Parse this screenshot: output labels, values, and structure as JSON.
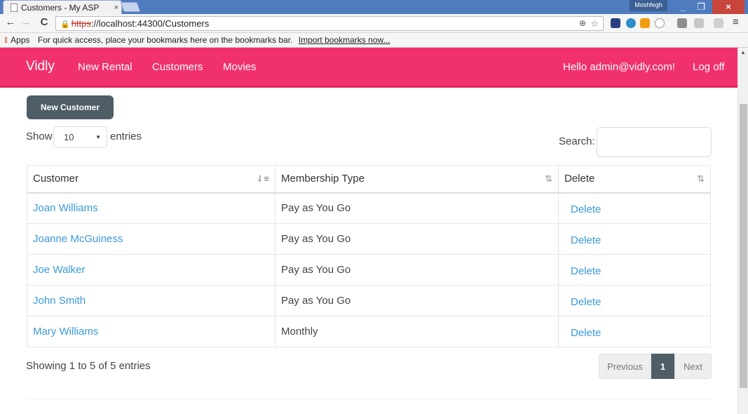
{
  "browser": {
    "tab_title": "Customers - My ASP",
    "tab_close": "×",
    "profile_name": "Moshfegh",
    "win_min": "_",
    "win_max": "❐",
    "win_close": "×",
    "url_scheme": "https",
    "url_rest": "://localhost:44300/Customers",
    "bookmarks_apps": "Apps",
    "bookmarks_hint": "For quick access, place your bookmarks here on the bookmarks bar.",
    "bookmarks_import": "Import bookmarks now..."
  },
  "navbar": {
    "brand": "Vidly",
    "links": [
      "New Rental",
      "Customers",
      "Movies"
    ],
    "greeting": "Hello admin@vidly.com!",
    "logoff": "Log off",
    "color": "#f1306e"
  },
  "actions": {
    "new_customer": "New Customer"
  },
  "table_controls": {
    "show_label": "Show",
    "page_length": "10",
    "entries_label": "entries",
    "search_label": "Search:",
    "search_value": ""
  },
  "table": {
    "headers": [
      "Customer",
      "Membership Type",
      "Delete"
    ],
    "rows": [
      {
        "customer": "Joan Williams",
        "membership": "Pay as You Go",
        "action": "Delete"
      },
      {
        "customer": "Joanne McGuiness",
        "membership": "Pay as You Go",
        "action": "Delete"
      },
      {
        "customer": "Joe Walker",
        "membership": "Pay as You Go",
        "action": "Delete"
      },
      {
        "customer": "John Smith",
        "membership": "Pay as You Go",
        "action": "Delete"
      },
      {
        "customer": "Mary Williams",
        "membership": "Monthly",
        "action": "Delete"
      }
    ]
  },
  "footer": {
    "info": "Showing 1 to 5 of 5 entries",
    "prev": "Previous",
    "current_page": "1",
    "next": "Next"
  }
}
